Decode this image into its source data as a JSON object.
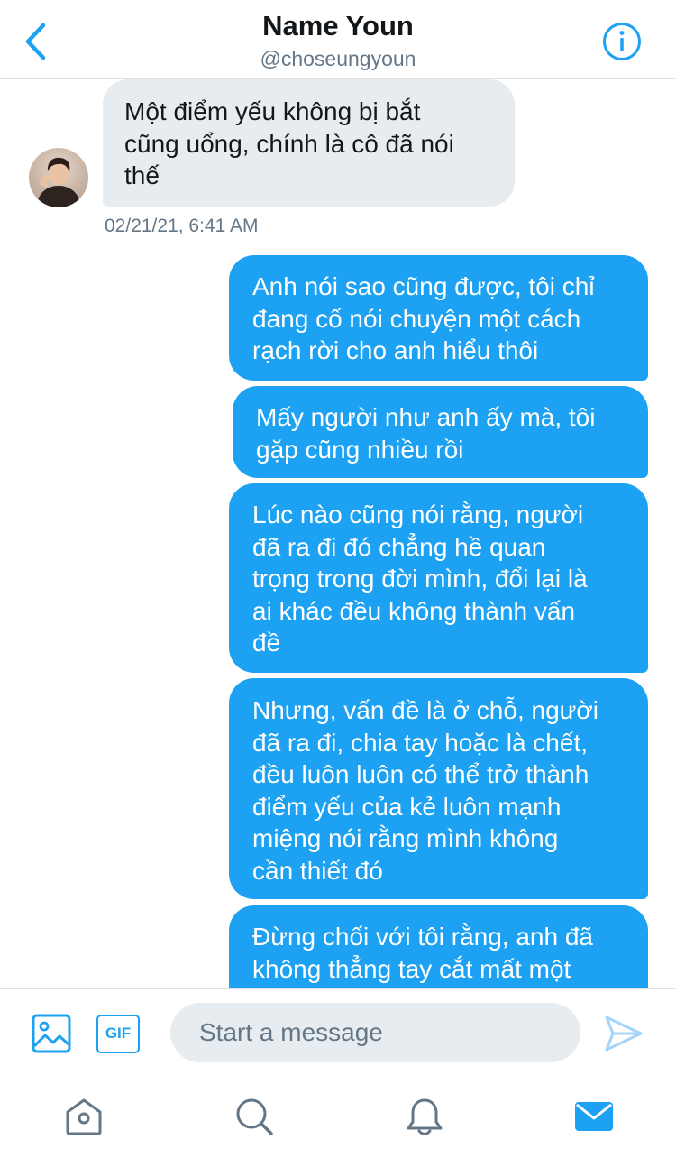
{
  "header": {
    "title": "Name Youn",
    "handle": "@choseungyoun"
  },
  "conversation": {
    "received": {
      "text": "Một điểm yếu không bị bắt\ncũng uổng, chính là cô đã nói\nthế",
      "timestamp": "02/21/21, 6:41 AM"
    },
    "sent": [
      {
        "text": "Anh nói sao cũng được, tôi chỉ\nđang cố nói chuyện một cách\nrạch rời cho anh hiểu thôi"
      },
      {
        "text": "Mấy người như anh ấy mà, tôi\ngặp cũng nhiều rồi"
      },
      {
        "text": "Lúc nào cũng nói rằng, người\nđã ra đi đó chẳng hề quan\ntrọng trong đời mình, đổi lại là\nai khác đều không thành vấn\nđề"
      },
      {
        "text": "Nhưng, vấn đề là ở chỗ, người\nđã ra đi, chia tay hoặc là chết,\nđều luôn luôn có thể trở thành\nđiểm yếu của kẻ luôn mạnh\nmiệng nói rằng mình không\ncần thiết đó"
      },
      {
        "text": "Đừng chối với tôi rằng, anh đã\nkhông thẳng tay cắt mất một"
      }
    ]
  },
  "composer": {
    "gif_label": "GIF",
    "placeholder": "Start a message"
  },
  "colors": {
    "accent": "#1da1f2",
    "received_bubble": "#e6ecf0",
    "secondary_text": "#657786",
    "icon_gray": "#657786"
  },
  "icons": [
    "back-chevron-icon",
    "info-icon",
    "image-icon",
    "gif-icon",
    "send-icon",
    "home-icon",
    "search-icon",
    "bell-icon",
    "mail-icon"
  ]
}
